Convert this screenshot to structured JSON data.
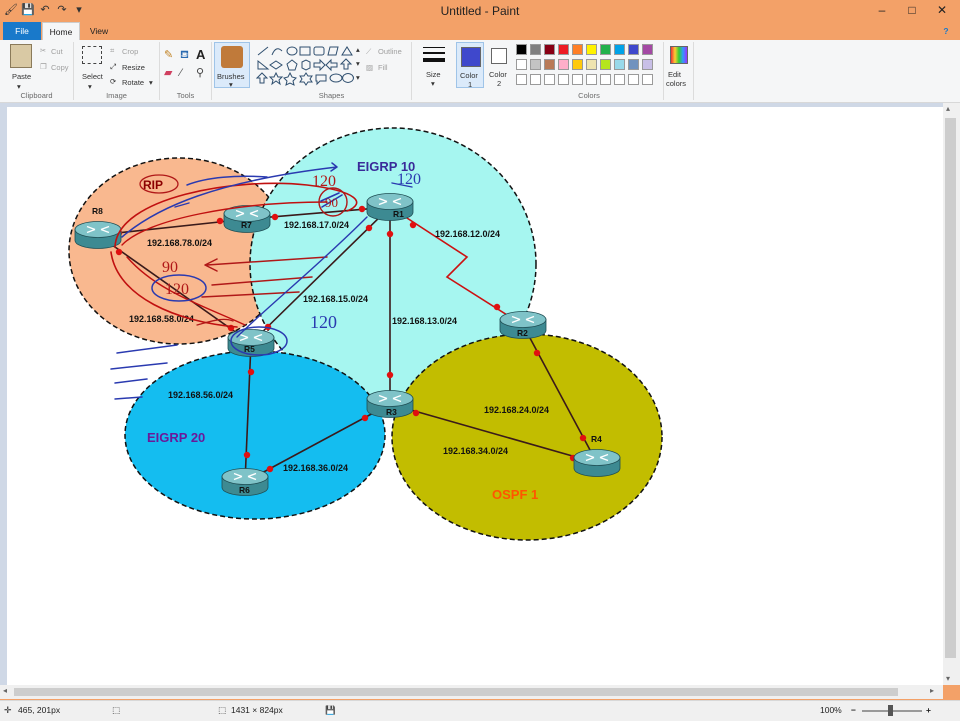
{
  "window": {
    "title": "Untitled - Paint",
    "minimize": "–",
    "maximize": "□",
    "close": "✕",
    "help": "?"
  },
  "quick_access": [
    {
      "icon": "save-icon",
      "glyph": "💾"
    },
    {
      "icon": "undo-icon",
      "glyph": "↶"
    },
    {
      "icon": "redo-icon",
      "glyph": "↷"
    },
    {
      "icon": "customize-icon",
      "glyph": "▾"
    }
  ],
  "tabs": {
    "file": "File",
    "home": "Home",
    "view": "View"
  },
  "ribbon": {
    "clipboard": {
      "label": "Clipboard",
      "paste": "Paste",
      "cut": "Cut",
      "copy": "Copy"
    },
    "image": {
      "label": "Image",
      "select": "Select",
      "crop": "Crop",
      "resize": "Resize",
      "rotate": "Rotate"
    },
    "tools": {
      "label": "Tools"
    },
    "brushes": {
      "label": "Brushes"
    },
    "shapes": {
      "label": "Shapes",
      "outline": "Outline",
      "fill": "Fill"
    },
    "size": {
      "label": "Size"
    },
    "color1": {
      "label": "Color",
      "sub": "1"
    },
    "color2": {
      "label": "Color",
      "sub": "2"
    },
    "colors": {
      "label": "Colors"
    },
    "edit_colors": {
      "label": "Edit",
      "sub": "colors"
    }
  },
  "palette": [
    "#000000",
    "#7f7f7f",
    "#880015",
    "#ed1c24",
    "#ff7f27",
    "#fff200",
    "#22b14c",
    "#00a2e8",
    "#3f48cc",
    "#a349a4",
    "#ffffff",
    "#c3c3c3",
    "#b97a57",
    "#ffaec9",
    "#ffc90e",
    "#efe4b0",
    "#b5e61d",
    "#99d9ea",
    "#7092be",
    "#c8bfe7",
    "#ffffff",
    "#ffffff",
    "#ffffff",
    "#ffffff",
    "#ffffff",
    "#ffffff",
    "#ffffff",
    "#ffffff",
    "#ffffff",
    "#ffffff"
  ],
  "colors_active": {
    "color1": "#3f48cc",
    "color2": "#ffffff"
  },
  "diagram": {
    "domains": [
      {
        "id": "rip",
        "label": "RIP",
        "fill": "#f9b88f",
        "label_color": "#8b0000"
      },
      {
        "id": "eigrp10",
        "label": "EIGRP 10",
        "fill": "#a6f6f0",
        "label_color": "#3a2a99"
      },
      {
        "id": "eigrp20",
        "label": "EIGRP 20",
        "fill": "#14bdf0",
        "label_color": "#6a1a9a"
      },
      {
        "id": "ospf1",
        "label": "OSPF 1",
        "fill": "#c2bd00",
        "label_color": "#ff5500"
      }
    ],
    "routers": [
      "R1",
      "R2",
      "R3",
      "R4",
      "R5",
      "R6",
      "R7",
      "R8"
    ],
    "networks": [
      "192.168.12.0/24",
      "192.168.13.0/24",
      "192.168.15.0/24",
      "192.168.17.0/24",
      "192.168.78.0/24",
      "192.168.58.0/24",
      "192.168.56.0/24",
      "192.168.36.0/24",
      "192.168.34.0/24",
      "192.168.24.0/24"
    ],
    "annotations": {
      "n120a": "120",
      "n90": "90",
      "n120b": "120",
      "n120c": "120",
      "n120d": "120",
      "n90b": "90"
    }
  },
  "status": {
    "cursor": "465, 201px",
    "dimensions": "1431 × 824px",
    "zoom": "100%",
    "zoom_out": "−",
    "zoom_in": "+"
  }
}
